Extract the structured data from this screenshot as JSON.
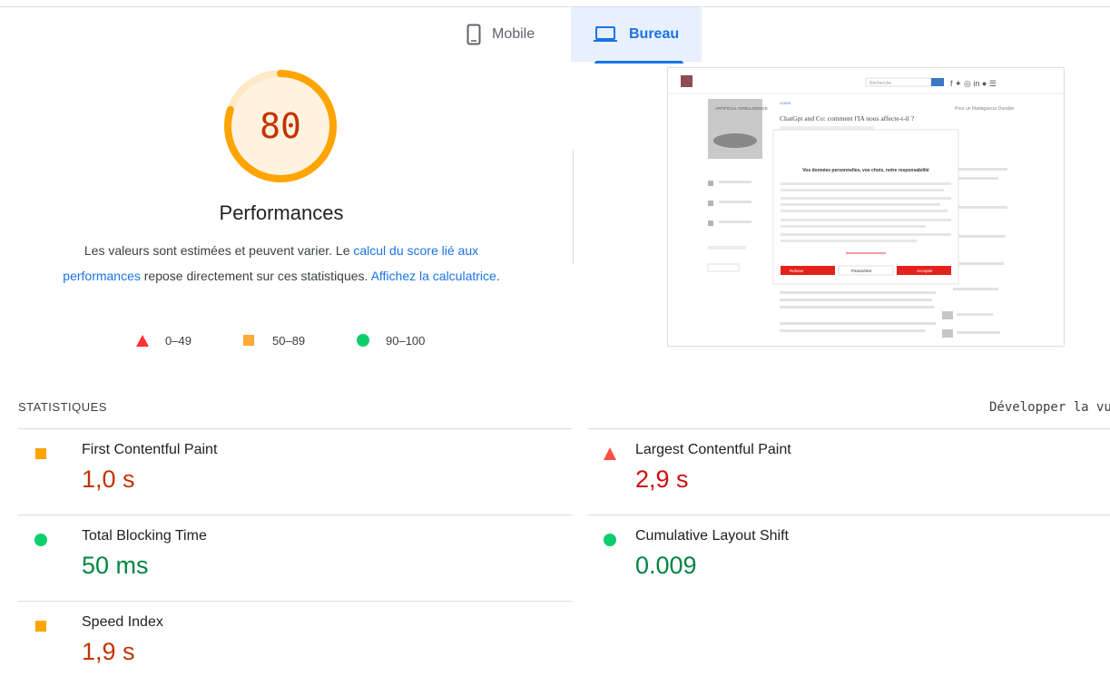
{
  "tabs": [
    {
      "label": "Mobile",
      "icon": "smartphone-icon",
      "active": false
    },
    {
      "label": "Bureau",
      "icon": "laptop-icon",
      "active": true
    }
  ],
  "performance": {
    "score": "80",
    "score_fraction": 0.8,
    "title": "Performances",
    "desc_part1": "Les valeurs sont estimées et peuvent varier. Le ",
    "desc_link1": "calcul du score lié aux performances",
    "desc_part2": " repose directement sur ces statistiques. ",
    "desc_link2": "Affichez la calculatrice",
    "desc_part3": ".",
    "legend": [
      {
        "label": "0–49",
        "shape": "triangle-icon",
        "color": "#ff3333"
      },
      {
        "label": "50–89",
        "shape": "square-icon",
        "color": "#ffaa33"
      },
      {
        "label": "90–100",
        "shape": "circle-icon",
        "color": "#0cce6b"
      }
    ]
  },
  "screenshot_preview": {
    "search_placeholder": "Recherche",
    "category": "GUIDE",
    "book_title": "ARTIFICIAL INTELLIGENCE",
    "article_title": "ChatGpt and Co: comment l'IA nous affecte-t-il ?",
    "side_text": "Pour un Madagascar Durable",
    "modal_title": "Vos données personnelles, vos choix, notre responsabilité",
    "modal_buttons": [
      "Refuser",
      "Paramétrer",
      "Accepter"
    ]
  },
  "statistics": {
    "heading": "STATISTIQUES",
    "expand_label": "Développer la vue",
    "metrics": [
      {
        "name": "First Contentful Paint",
        "value": "1,0 s",
        "status": "average",
        "icon": "square-icon"
      },
      {
        "name": "Largest Contentful Paint",
        "value": "2,9 s",
        "status": "fail",
        "icon": "triangle-icon"
      },
      {
        "name": "Total Blocking Time",
        "value": "50 ms",
        "status": "pass",
        "icon": "circle-icon"
      },
      {
        "name": "Cumulative Layout Shift",
        "value": "0.009",
        "status": "pass",
        "icon": "circle-icon"
      },
      {
        "name": "Speed Index",
        "value": "1,9 s",
        "status": "average",
        "icon": "square-icon"
      }
    ]
  },
  "colors": {
    "pass": "#0cce6b",
    "average": "#ffa400",
    "fail": "#ff4e42",
    "pass_text": "#018642",
    "average_text": "#c33300",
    "fail_text": "#cc0f0f",
    "accent": "#1a73e8"
  }
}
